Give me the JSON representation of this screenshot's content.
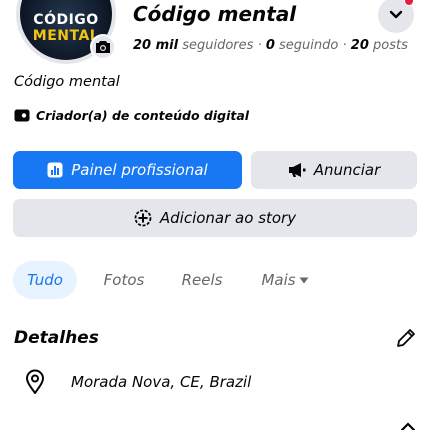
{
  "profile": {
    "name": "Código mental",
    "logo_text_line1": "CÓDIGO",
    "logo_text_line2": "MENTAL",
    "followers_count": "20 mil",
    "followers_label": "seguidores",
    "separator": "·",
    "following_count": "0",
    "following_label": "seguindo",
    "posts_count": "20",
    "posts_label": "posts",
    "bio": "Código mental",
    "category": "Criador(a) de conteúdo digital"
  },
  "actions": {
    "primary_label": "Painel profissional",
    "secondary_label": "Anunciar",
    "story_label": "Adicionar ao story"
  },
  "tabs": [
    {
      "label": "Tudo",
      "active": true
    },
    {
      "label": "Fotos",
      "active": false
    },
    {
      "label": "Reels",
      "active": false
    },
    {
      "label": "Mais",
      "active": false
    }
  ],
  "details": {
    "title": "Detalhes",
    "location": "Morada Nova, CE, Brazil"
  },
  "icons": {
    "camera": "camera-icon",
    "chevron": "chevron-down-icon",
    "category": "category-icon",
    "dashboard": "dashboard-icon",
    "megaphone": "megaphone-icon",
    "add_story": "plus-circle-icon",
    "edit": "pencil-icon",
    "location": "location-pin-icon"
  },
  "colors": {
    "brand": "#1877f2",
    "notification": "#e41e3f",
    "button_gray": "#e4e6eb",
    "tab_active_bg": "#e7f3ff"
  }
}
